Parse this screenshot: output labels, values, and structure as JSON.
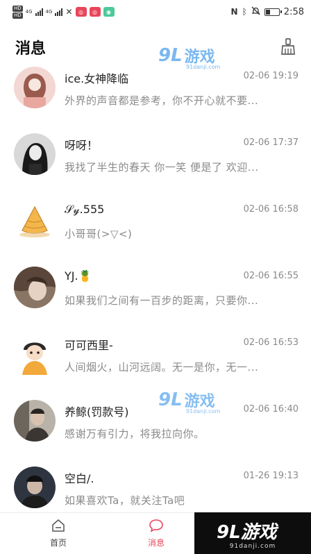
{
  "status_bar": {
    "left_badges": [
      "HD",
      "HD"
    ],
    "net_left": "4G",
    "net_right": "4G",
    "time": "2:58",
    "battery_percent": 30,
    "app_icon_colors": [
      "#e8455a",
      "#e8455a",
      "#4cc99a"
    ]
  },
  "header": {
    "title": "消息",
    "clear_icon": "broom-icon"
  },
  "watermark": {
    "logo_num": "9L",
    "logo_text": "游戏",
    "url": "91danji.com"
  },
  "conversations": [
    {
      "name": "ice.女神降临",
      "time": "02-06 19:19",
      "preview": "外界的声音都是参考，你不开心就不要..."
    },
    {
      "name": "呀呀！",
      "time": "02-06 17:37",
      "preview": "我找了半生的春天 你一笑 便是了 欢迎..."
    },
    {
      "name": "𝒮𝓎.555",
      "time": "02-06 16:58",
      "preview": "小哥哥(>▽<)"
    },
    {
      "name": "YJ.🍍",
      "time": "02-06 16:55",
      "preview": "如果我们之间有一百步的距离，只要你..."
    },
    {
      "name": "可可西里-",
      "time": "02-06 16:53",
      "preview": "人间烟火，山河远阔。无一是你，无一..."
    },
    {
      "name": "养鲸(罚款号)",
      "time": "02-06 16:40",
      "preview": "感谢万有引力，将我拉向你。"
    },
    {
      "name": "空白/.",
      "time": "01-26 19:13",
      "preview": "如果喜欢Ta，就关注Ta吧"
    }
  ],
  "bottom_nav": {
    "home_label": "首页",
    "messages_label": "消息",
    "active_color": "#e8455a"
  },
  "brand": {
    "logo": "9L游戏",
    "url": "91danji.com"
  }
}
